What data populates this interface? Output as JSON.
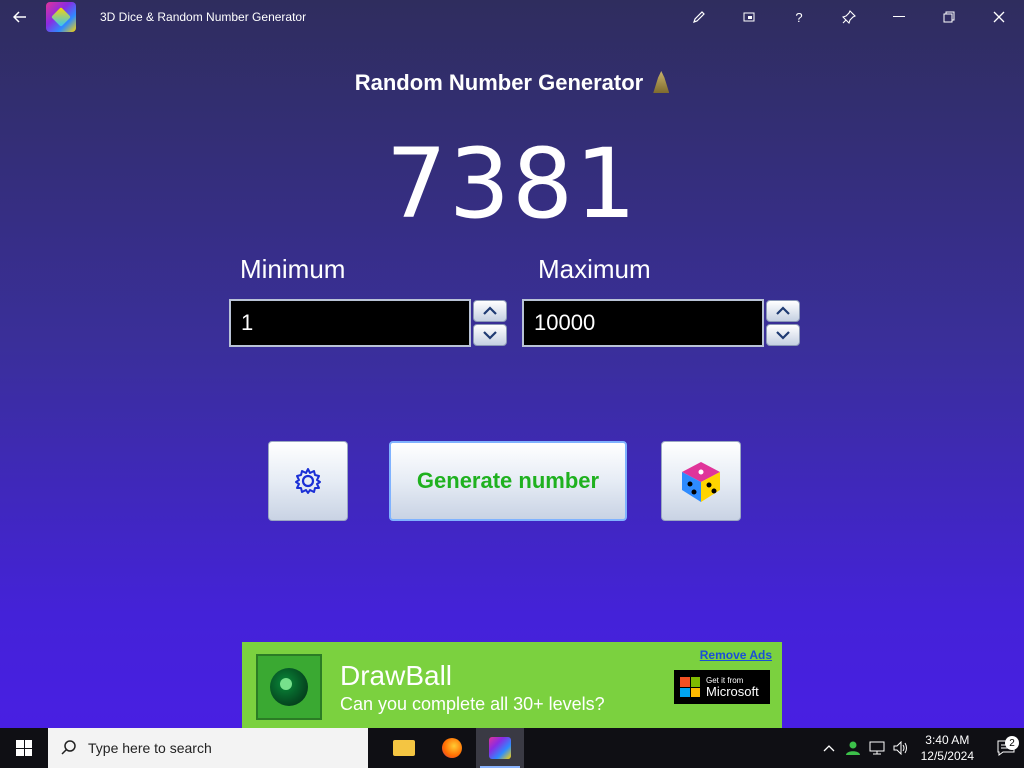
{
  "window": {
    "title": "3D Dice & Random Number Generator",
    "controls": [
      "edit-icon",
      "compact-overlay-icon",
      "help-icon",
      "pin-icon",
      "minimize-icon",
      "restore-icon",
      "close-icon"
    ]
  },
  "main": {
    "heading": "Random Number Generator",
    "result": "7381",
    "minimum_label": "Minimum",
    "maximum_label": "Maximum",
    "minimum_value": "1",
    "maximum_value": "10000",
    "generate_label": "Generate number"
  },
  "ad": {
    "title": "DrawBall",
    "subtitle": "Can you complete all 30+ levels?",
    "remove_ads": "Remove Ads",
    "store_small": "Get it from",
    "store_big": "Microsoft"
  },
  "taskbar": {
    "search_placeholder": "Type here to search",
    "time": "3:40 AM",
    "date": "12/5/2024",
    "notification_count": "2"
  },
  "colors": {
    "generate_text": "#1fb11f",
    "ad_background": "#7bd13f",
    "background_bottom": "#4a1ee6"
  }
}
